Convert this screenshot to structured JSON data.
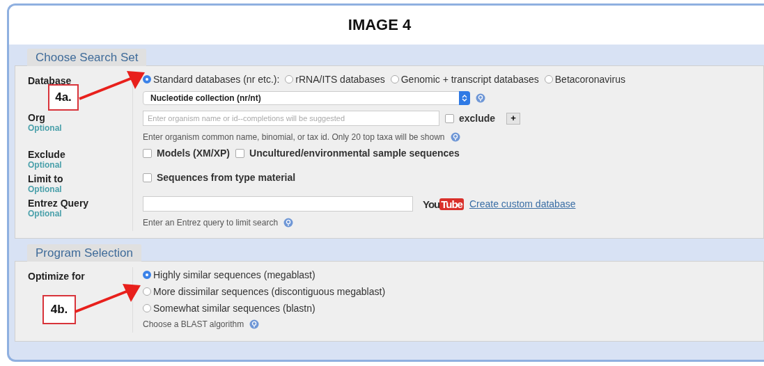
{
  "title": "IMAGE 4",
  "search_set": {
    "legend": "Choose Search Set",
    "database": {
      "label": "Database",
      "callout": "4a.",
      "options": [
        {
          "label": "Standard databases (nr etc.):",
          "selected": true
        },
        {
          "label": "rRNA/ITS databases",
          "selected": false
        },
        {
          "label": "Genomic + transcript databases",
          "selected": false
        },
        {
          "label": "Betacoronavirus",
          "selected": false
        }
      ],
      "select_value": "Nucleotide collection (nr/nt)"
    },
    "organism": {
      "label": "Org",
      "optional": "Optional",
      "placeholder": "Enter organism name or id--completions will be suggested",
      "exclude": {
        "label": "exclude",
        "checked": false
      },
      "add_button": "+",
      "hint": "Enter organism common name, binomial, or tax id. Only 20 top taxa will be shown"
    },
    "exclude": {
      "label": "Exclude",
      "optional": "Optional",
      "options": [
        {
          "label": "Models (XM/XP)",
          "checked": false
        },
        {
          "label": "Uncultured/environmental sample sequences",
          "checked": false
        }
      ]
    },
    "limit_to": {
      "label": "Limit to",
      "optional": "Optional",
      "options": [
        {
          "label": "Sequences from type material",
          "checked": false
        }
      ]
    },
    "entrez": {
      "label": "Entrez Query",
      "optional": "Optional",
      "logo": {
        "left": "You",
        "right": "Tube"
      },
      "link": "Create custom database",
      "hint": "Enter an Entrez query to limit search"
    }
  },
  "program_selection": {
    "legend": "Program Selection",
    "label": "Optimize for",
    "callout": "4b.",
    "options": [
      {
        "label": "Highly similar sequences (megablast)",
        "selected": true
      },
      {
        "label": "More dissimilar sequences (discontiguous megablast)",
        "selected": false
      },
      {
        "label": "Somewhat similar sequences (blastn)",
        "selected": false
      }
    ],
    "hint": "Choose a BLAST algorithm"
  }
}
